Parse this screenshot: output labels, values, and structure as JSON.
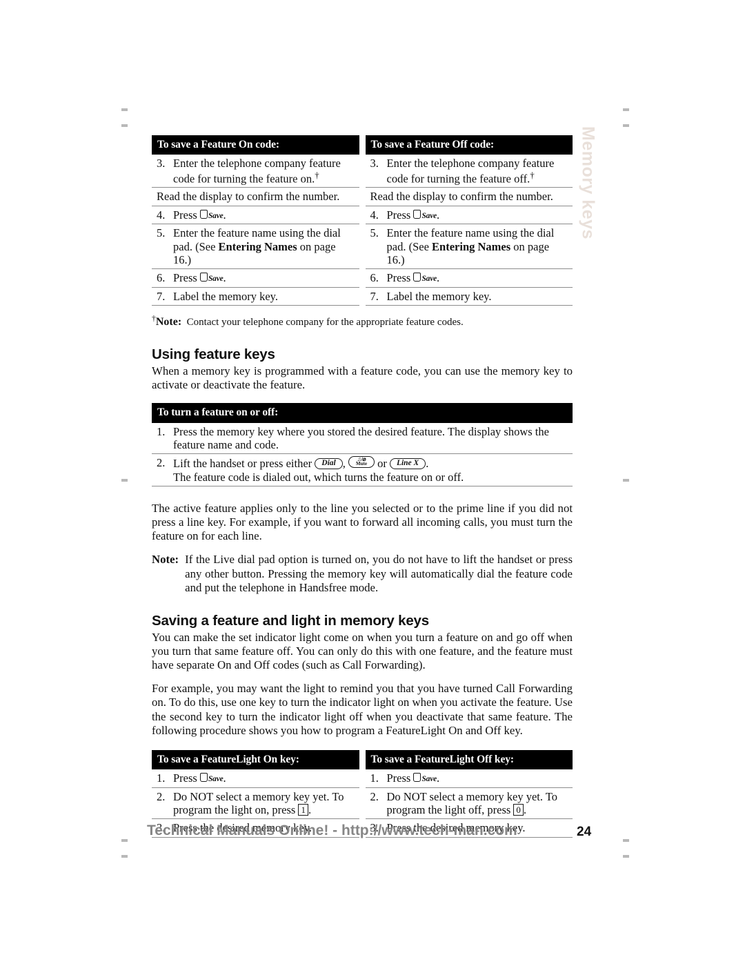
{
  "page": {
    "side_tab_label": "Memory keys",
    "page_number": "24",
    "footer_text": "Technical Manuals Online! - http://www.tech-man.com",
    "side_tab_color": "#e9e0da",
    "header_bg_color": "#000000",
    "header_text_color": "#ffffff",
    "rule_color": "#8c8c8c",
    "footer_text_color": "#868686"
  },
  "table_feature_codes": {
    "columns": [
      {
        "header": "To save a Feature On code:",
        "rows": [
          {
            "num": "3.",
            "text_before": "Enter the telephone company feature code for turning the feature on.",
            "dagger": true
          },
          {
            "num": "",
            "text_before": "Read the display to confirm the number."
          },
          {
            "num": "4.",
            "text_before": "Press ",
            "key": "Save",
            "text_after": "."
          },
          {
            "num": "5.",
            "text_before": "Enter the feature name using the dial pad. (See ",
            "bold": "Entering Names",
            "text_after": " on page 16.)"
          },
          {
            "num": "6.",
            "text_before": "Press ",
            "key": "Save",
            "text_after": "."
          },
          {
            "num": "7.",
            "text_before": "Label the memory key."
          }
        ]
      },
      {
        "header": "To save a Feature Off code:",
        "rows": [
          {
            "num": "3.",
            "text_before": "Enter the telephone company feature code for turning the feature off.",
            "dagger": true
          },
          {
            "num": "",
            "text_before": "Read the display to confirm the number."
          },
          {
            "num": "4.",
            "text_before": "Press ",
            "key": "Save",
            "text_after": "."
          },
          {
            "num": "5.",
            "text_before": "Enter the feature name using the dial pad. (See ",
            "bold": "Entering Names",
            "text_after": " on page 16.)"
          },
          {
            "num": "6.",
            "text_before": "Press ",
            "key": "Save",
            "text_after": "."
          },
          {
            "num": "7.",
            "text_before": "Label the memory key."
          }
        ]
      }
    ]
  },
  "dagger_note": {
    "label": "Note:",
    "text": "Contact your telephone company for the appropriate feature codes."
  },
  "section_using_feature_keys": {
    "title": "Using feature keys",
    "intro": "When a memory key is programmed with a feature code, you can use the memory key to activate or deactivate the feature.",
    "table": {
      "header": "To turn a feature on or off:",
      "rows": [
        {
          "num": "1.",
          "text": "Press the memory key where you stored the desired feature. The display shows the feature name and code."
        },
        {
          "num": "2.",
          "text_before": "Lift the handset or press either ",
          "key1": "Dial",
          "sep1": ", ",
          "key2_top": "♫/⌀",
          "key2_bot": "Mute",
          "sep2": " or ",
          "key3": "Line X",
          "text_after": ".",
          "text_line2": "The feature code is dialed out, which turns the feature on or off."
        }
      ]
    },
    "paragraph_active_feature": "The active feature applies only to the line you selected or to the prime line if you did not press a line key. For example, if you want to forward all incoming calls, you must turn the feature on for each line.",
    "note": {
      "label": "Note:",
      "text": "If the Live dial pad option is turned on, you do not have to lift the handset or press any other button. Pressing the memory key will automatically dial the feature code and put the telephone in Handsfree mode."
    }
  },
  "section_saving_feature_light": {
    "title": "Saving a feature and light in memory keys",
    "paragraph_1": "You can make the set indicator light come on when you turn a feature on and go off when you turn that same feature off. You can only do this with one feature, and the feature must have separate On and Off codes (such as Call Forwarding).",
    "paragraph_2": "For example, you may want the light to remind you that you have turned Call Forwarding on. To do this, use one key to turn the indicator light on when you activate the feature. Use the second key to turn the indicator light off when you deactivate that same feature. The following procedure shows you how to program a FeatureLight On and Off key.",
    "table": {
      "columns": [
        {
          "header": "To save a FeatureLight On key:",
          "rows": [
            {
              "num": "1.",
              "text_before": "Press ",
              "key": "Save",
              "text_after": "."
            },
            {
              "num": "2.",
              "text_before": "Do NOT select a memory key yet. To program the light on, press ",
              "keycap": "1",
              "text_after": "."
            },
            {
              "num": "3.",
              "text_before": "Press the desired memory key."
            }
          ]
        },
        {
          "header": "To save a FeatureLight Off key:",
          "rows": [
            {
              "num": "1.",
              "text_before": "Press ",
              "key": "Save",
              "text_after": "."
            },
            {
              "num": "2.",
              "text_before": "Do NOT select a memory key yet. To program the light off, press ",
              "keycap": "0",
              "text_after": "."
            },
            {
              "num": "3.",
              "text_before": "Press the desired memory key."
            }
          ]
        }
      ]
    }
  }
}
